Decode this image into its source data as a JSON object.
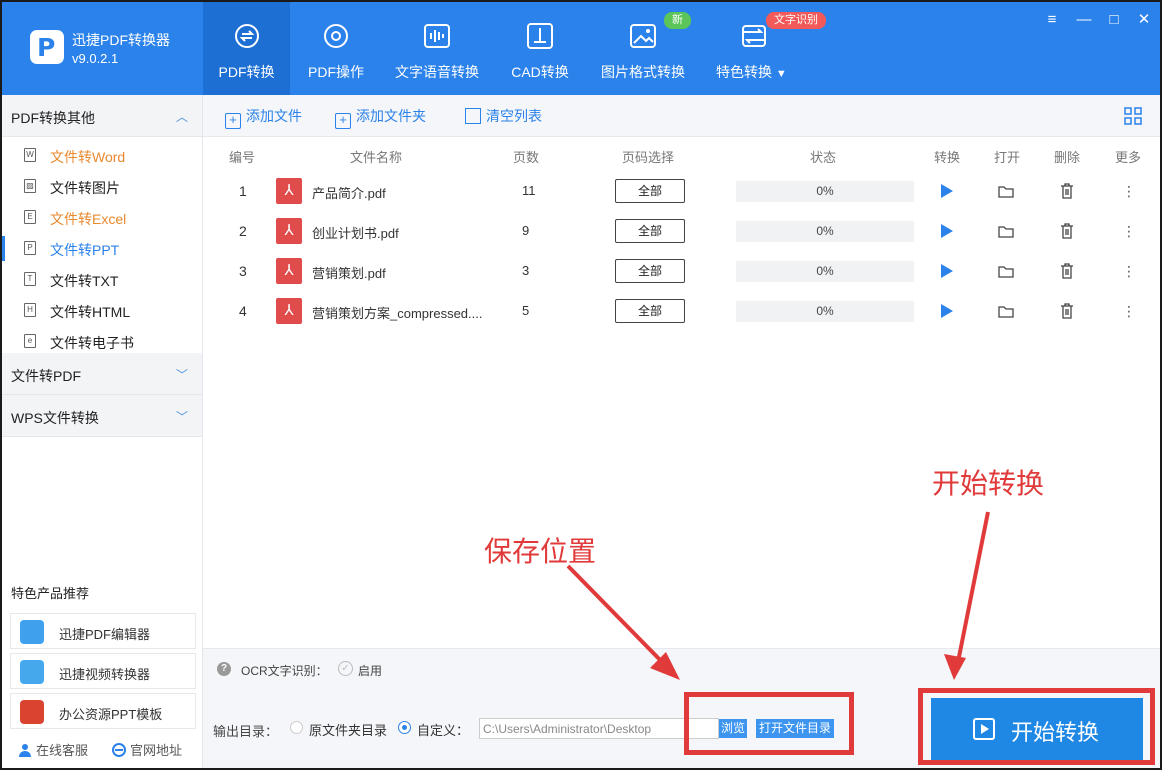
{
  "app": {
    "logo_letter": "P",
    "name": "迅捷PDF转换器",
    "version": "v9.0.2.1"
  },
  "nav_tabs": [
    {
      "label": "PDF转换",
      "icon": "pdf-convert-icon",
      "active": true
    },
    {
      "label": "PDF操作",
      "icon": "pdf-operate-icon"
    },
    {
      "label": "文字语音转换",
      "icon": "audio-wave-icon"
    },
    {
      "label": "CAD转换",
      "icon": "cad-icon"
    },
    {
      "label": "图片格式转换",
      "icon": "image-icon"
    },
    {
      "label": "特色转换",
      "icon": "special-convert-icon"
    }
  ],
  "badges": {
    "new": "新",
    "ocr": "文字识别"
  },
  "window_controls": [
    "menu",
    "minimize",
    "maximize",
    "close"
  ],
  "sidebar": {
    "section_open": "PDF转换其他",
    "items": [
      {
        "label": "文件转Word",
        "icon": "W"
      },
      {
        "label": "文件转图片",
        "icon": "img"
      },
      {
        "label": "文件转Excel",
        "icon": "E"
      },
      {
        "label": "文件转PPT",
        "icon": "P"
      },
      {
        "label": "文件转TXT",
        "icon": "T"
      },
      {
        "label": "文件转HTML",
        "icon": "H"
      },
      {
        "label": "文件转电子书",
        "icon": "e"
      }
    ],
    "section_2": "文件转PDF",
    "section_3": "WPS文件转换",
    "featured_title": "特色产品推荐",
    "products": [
      "迅捷PDF编辑器",
      "迅捷视频转换器",
      "办公资源PPT模板"
    ],
    "footer_service": "在线客服",
    "footer_site": "官网地址"
  },
  "toolbar": {
    "add_file": "添加文件",
    "add_folder": "添加文件夹",
    "clear_list": "清空列表"
  },
  "table": {
    "headers": {
      "num": "编号",
      "name": "文件名称",
      "pages": "页数",
      "range": "页码选择",
      "status": "状态",
      "convert": "转换",
      "open": "打开",
      "delete": "删除",
      "more": "更多"
    },
    "rows": [
      {
        "num": "1",
        "name": "产品简介.pdf",
        "pages": "11",
        "range": "全部",
        "progress": "0%"
      },
      {
        "num": "2",
        "name": "创业计划书.pdf",
        "pages": "9",
        "range": "全部",
        "progress": "0%"
      },
      {
        "num": "3",
        "name": "营销策划.pdf",
        "pages": "3",
        "range": "全部",
        "progress": "0%"
      },
      {
        "num": "4",
        "name": "营销策划方案_compressed....",
        "pages": "5",
        "range": "全部",
        "progress": "0%"
      }
    ]
  },
  "ocr": {
    "label": "OCR文字识别：",
    "enable": "启用"
  },
  "output": {
    "label": "输出目录：",
    "option_source": "原文件夹目录",
    "option_custom": "自定义：",
    "path": "C:\\Users\\Administrator\\Desktop",
    "browse": "浏览",
    "open_dir": "打开文件目录"
  },
  "start_button": "开始转换",
  "annotations": {
    "save_location": "保存位置",
    "start_convert": "开始转换"
  },
  "colors": {
    "brand_blue": "#2b82ea",
    "annotation_red": "#e03a3a",
    "pdf_red": "#e04b4b",
    "orange_link": "#e8892e"
  }
}
